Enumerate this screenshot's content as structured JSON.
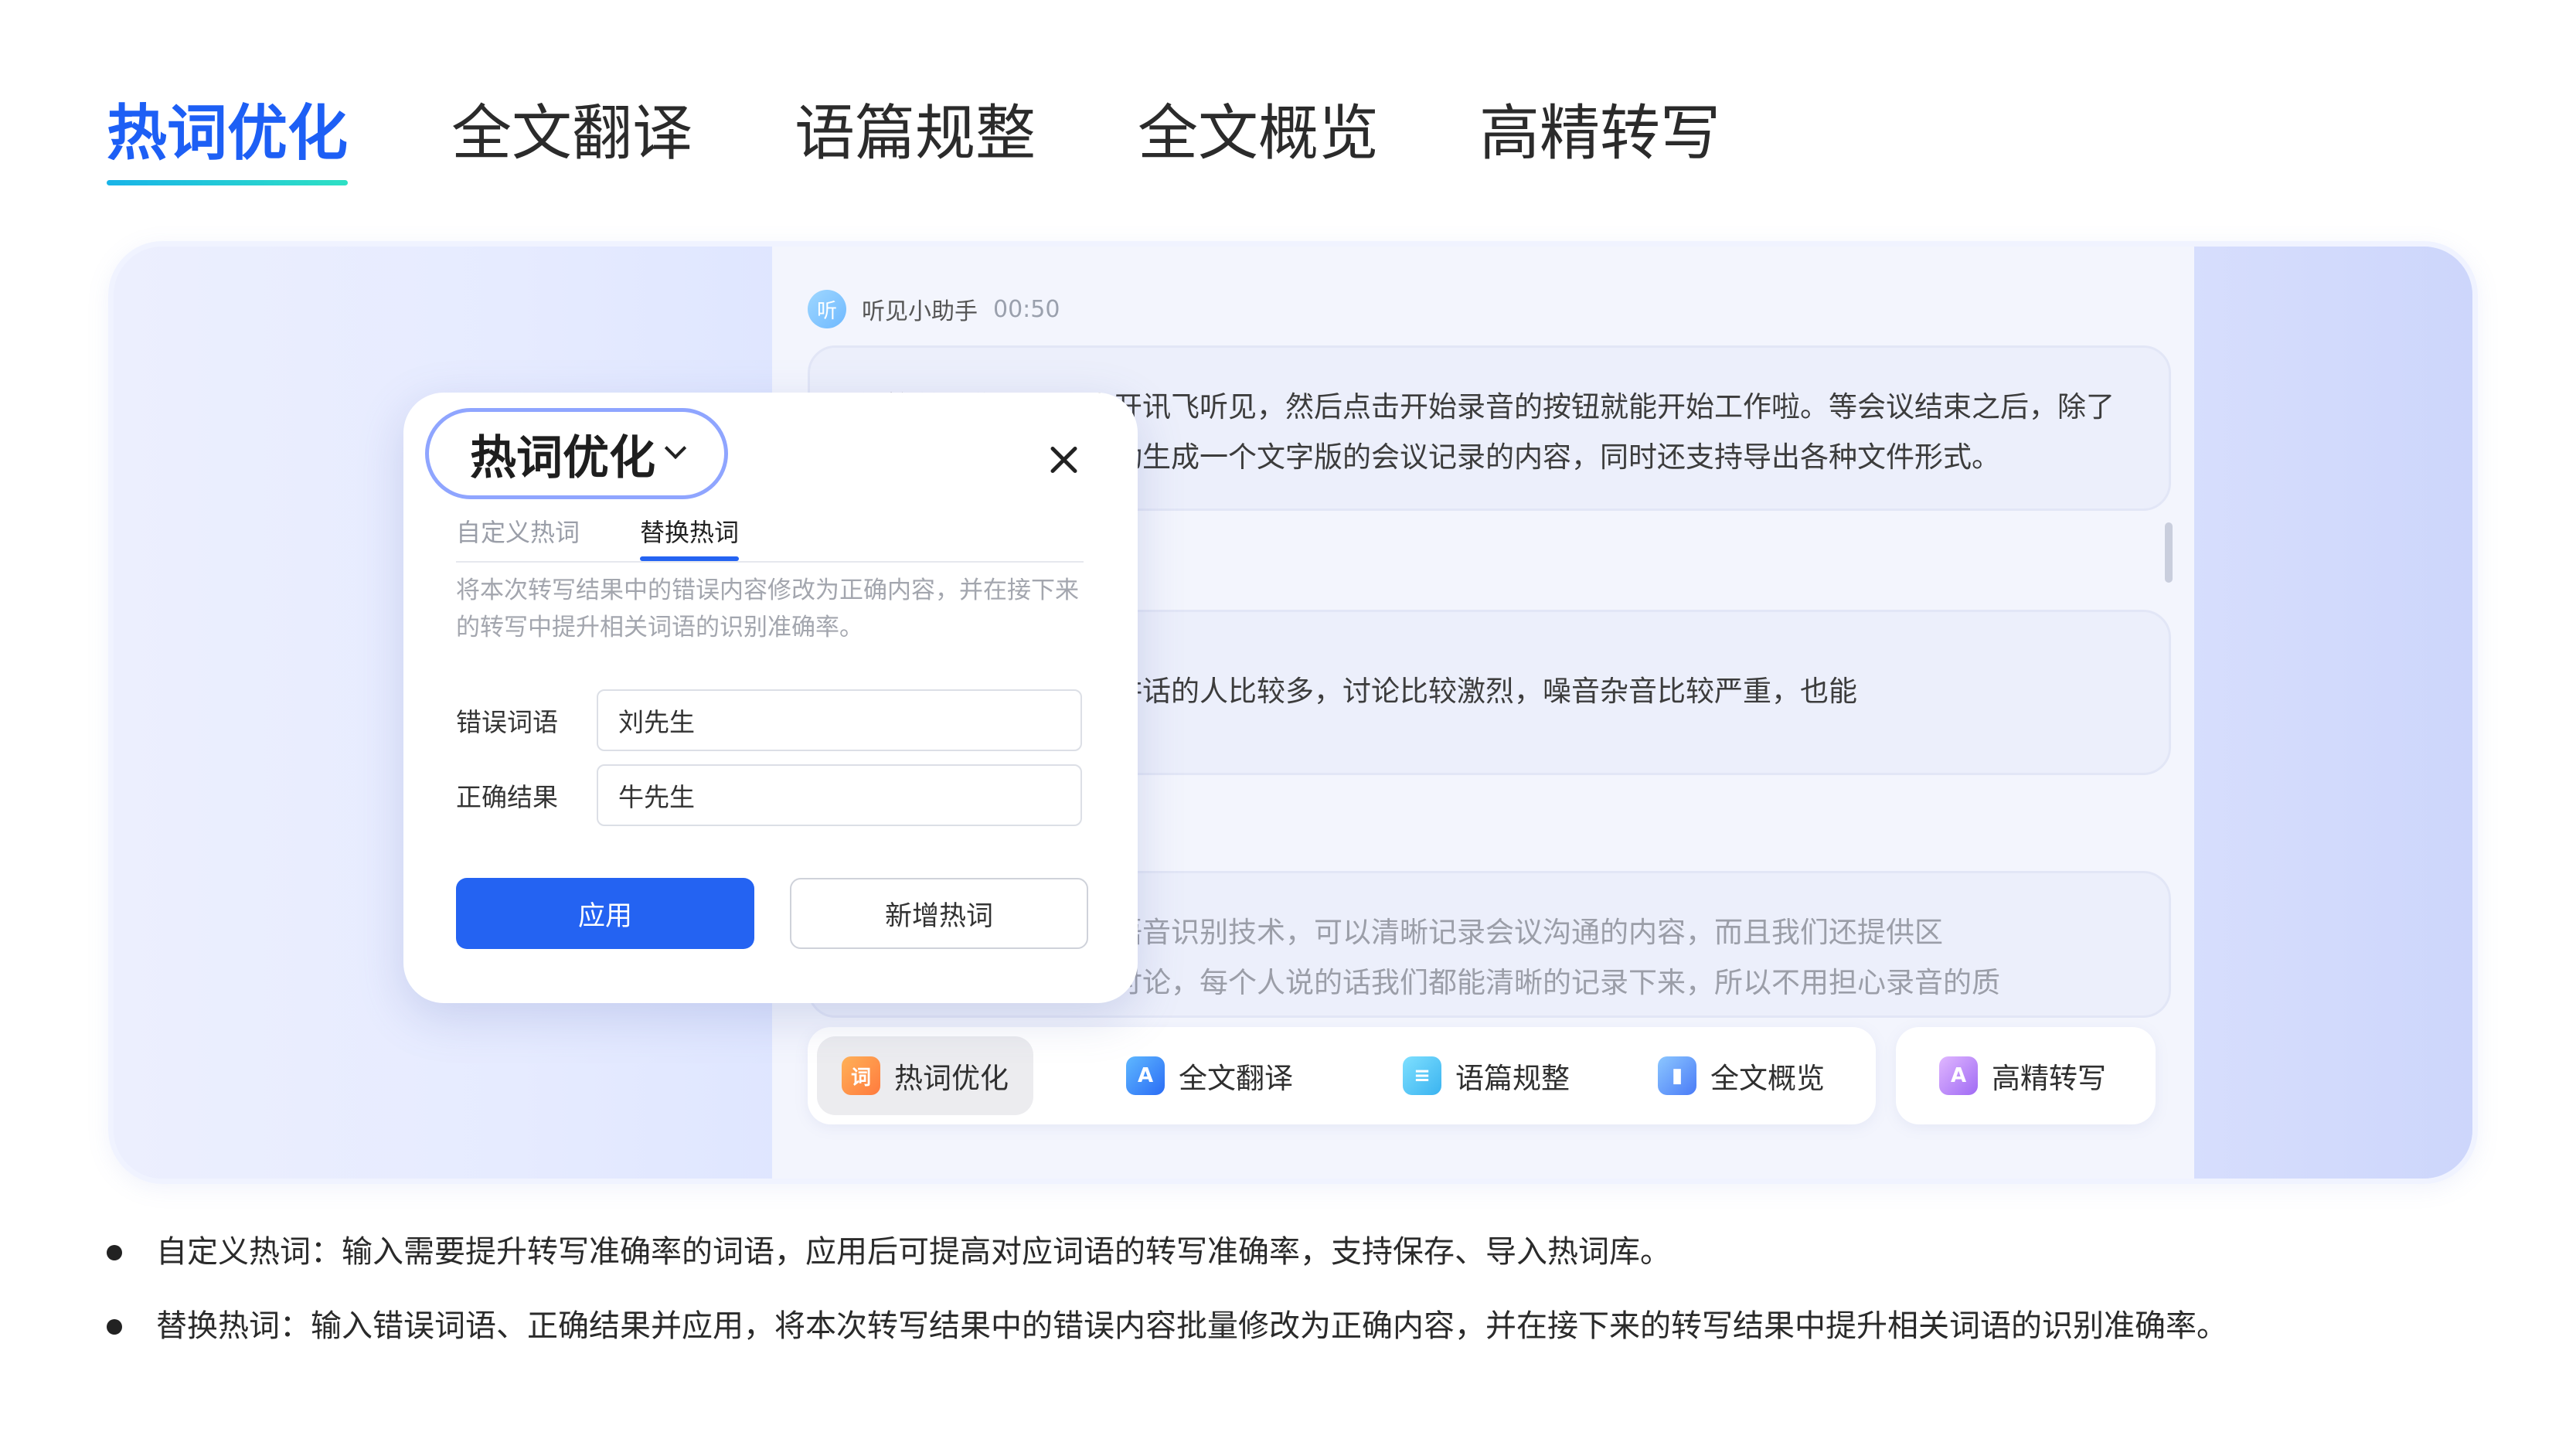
{
  "top_tabs": [
    {
      "label": "热词优化",
      "active": true
    },
    {
      "label": "全文翻译",
      "active": false
    },
    {
      "label": "语篇规整",
      "active": false
    },
    {
      "label": "全文概览",
      "active": false
    },
    {
      "label": "高精转写",
      "active": false
    }
  ],
  "chat": {
    "assistant_avatar": "听",
    "assistant_name": "听见小助手",
    "time": "00:50",
    "messages": [
      {
        "line1": "很简单，你只需要点开讯飞听见，然后点击开始录音的按钮就能开始工作啦。等会议结束之后，除了",
        "line2": "录音文件，听见会自动生成一个文字版的会议记录的内容，同时还支持导出各种文件形式。"
      },
      {
        "line1": "那如果会议的过程中讲话的人比较多，讨论比较激烈，噪音杂音比较严重，也能",
        "line2": ""
      },
      {
        "line1": "我们采用的是先进的语音识别技术，可以清晰记录会议沟通的内容，而且我们还提供区",
        "line2": "分说话人，再激烈的讨论，每个人说的话我们都能清晰的记录下来，所以不用担心录音的质"
      }
    ]
  },
  "function_bar": [
    {
      "icon": "ci-icon",
      "glyph": "词",
      "label": "热词优化",
      "active": true
    },
    {
      "icon": "translate-icon",
      "glyph": "A",
      "label": "全文翻译",
      "active": false
    },
    {
      "icon": "document-format-icon",
      "glyph": "≡",
      "label": "语篇规整",
      "active": false
    },
    {
      "icon": "book-overview-icon",
      "glyph": "▮",
      "label": "全文概览",
      "active": false
    },
    {
      "icon": "ai-transcribe-icon",
      "glyph": "A",
      "label": "高精转写",
      "active": false
    }
  ],
  "popup": {
    "title": "热词优化",
    "tabs": [
      {
        "label": "自定义热词",
        "active": false
      },
      {
        "label": "替换热词",
        "active": true
      }
    ],
    "description": "将本次转写结果中的错误内容修改为正确内容，并在接下来的转写中提升相关词语的识别准确率。",
    "fields": [
      {
        "label": "错误词语",
        "value": "刘先生"
      },
      {
        "label": "正确结果",
        "value": "牛先生"
      }
    ],
    "apply_label": "应用",
    "add_label": "新增热词"
  },
  "bullets": [
    "自定义热词：输入需要提升转写准确率的词语，应用后可提高对应词语的转写准确率，支持保存、导入热词库。",
    "替换热词：输入错误词语、正确结果并应用，将本次转写结果中的错误内容批量修改为正确内容，并在接下来的转写结果中提升相关词语的识别准确率。"
  ],
  "colors": {
    "accent": "#2463f2",
    "tab_active": "#1d5ff5"
  }
}
